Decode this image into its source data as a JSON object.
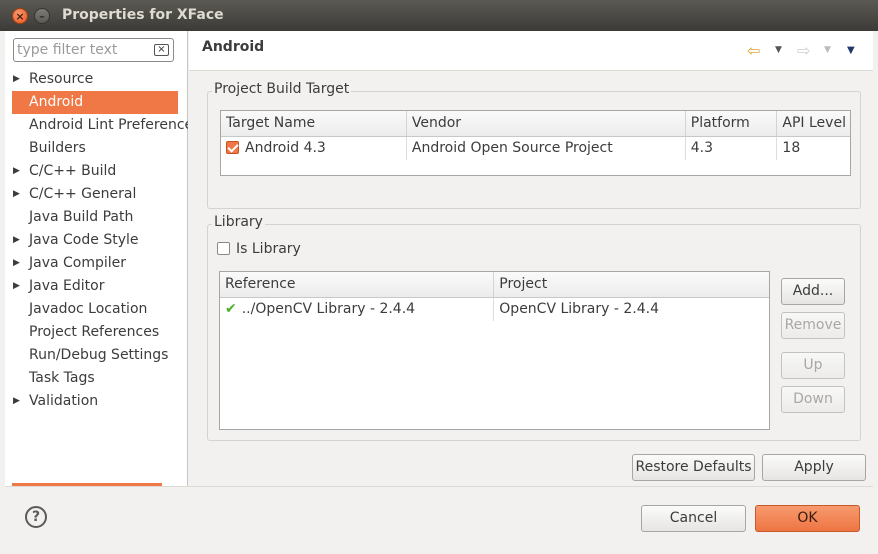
{
  "window": {
    "title": "Properties for XFace"
  },
  "filter": {
    "placeholder": "type filter text"
  },
  "tree": [
    {
      "label": "Resource",
      "expandable": true
    },
    {
      "label": "Android",
      "expandable": false,
      "selected": true
    },
    {
      "label": "Android Lint Preferences",
      "expandable": false
    },
    {
      "label": "Builders",
      "expandable": false
    },
    {
      "label": "C/C++ Build",
      "expandable": true
    },
    {
      "label": "C/C++ General",
      "expandable": true
    },
    {
      "label": "Java Build Path",
      "expandable": false
    },
    {
      "label": "Java Code Style",
      "expandable": true
    },
    {
      "label": "Java Compiler",
      "expandable": true
    },
    {
      "label": "Java Editor",
      "expandable": true
    },
    {
      "label": "Javadoc Location",
      "expandable": false
    },
    {
      "label": "Project References",
      "expandable": false
    },
    {
      "label": "Run/Debug Settings",
      "expandable": false
    },
    {
      "label": "Task Tags",
      "expandable": false
    },
    {
      "label": "Validation",
      "expandable": true
    }
  ],
  "page": {
    "title": "Android"
  },
  "build_target": {
    "group_label": "Project Build Target",
    "columns": [
      "Target Name",
      "Vendor",
      "Platform",
      "API Level"
    ],
    "rows": [
      {
        "checked": true,
        "target": "Android 4.3",
        "vendor": "Android Open Source Project",
        "platform": "4.3",
        "api": "18"
      }
    ]
  },
  "library": {
    "group_label": "Library",
    "is_library_label": "Is Library",
    "is_library_checked": false,
    "columns": [
      "Reference",
      "Project"
    ],
    "rows": [
      {
        "reference": "../OpenCV Library - 2.4.4",
        "project": "OpenCV Library - 2.4.4"
      }
    ],
    "buttons": {
      "add": "Add...",
      "remove": "Remove",
      "up": "Up",
      "down": "Down"
    }
  },
  "actions": {
    "restore_defaults": "Restore Defaults",
    "apply": "Apply"
  },
  "dialog": {
    "cancel": "Cancel",
    "ok": "OK"
  },
  "colors": {
    "accent": "#f07746",
    "titlebar": "#3c3b37"
  }
}
